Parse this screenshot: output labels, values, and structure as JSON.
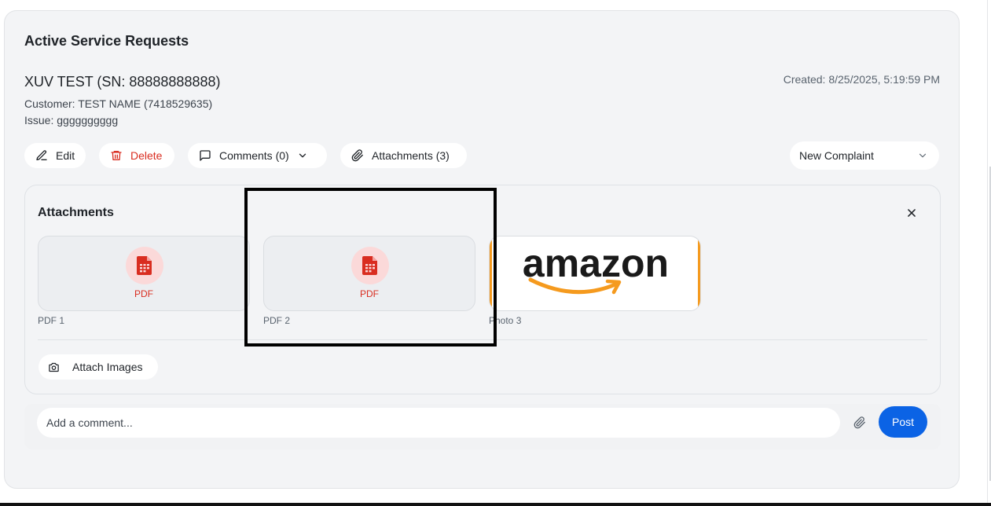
{
  "section": {
    "title": "Active Service Requests"
  },
  "request": {
    "title": "XUV TEST (SN: 88888888888)",
    "customer": "Customer: TEST NAME (7418529635)",
    "issue": "Issue: gggggggggg",
    "created": "Created: 8/25/2025, 5:19:59 PM"
  },
  "toolbar": {
    "edit_label": "Edit",
    "delete_label": "Delete",
    "comments_label": "Comments (0)",
    "attachments_label": "Attachments (3)",
    "status_selected": "New Complaint"
  },
  "attachments": {
    "title": "Attachments",
    "items": [
      {
        "type_label": "PDF",
        "caption": "PDF 1",
        "icon": "pdf-file-icon"
      },
      {
        "type_label": "PDF",
        "caption": "PDF 2",
        "icon": "pdf-file-icon"
      },
      {
        "type_label": "",
        "caption": "Photo 3",
        "icon": "amazon-logo-image"
      }
    ],
    "attach_images_label": "Attach Images"
  },
  "logo": {
    "text": "amazon"
  },
  "comment": {
    "placeholder": "Add a comment...",
    "post_label": "Post"
  },
  "colors": {
    "accent": "#0b63e5",
    "danger": "#d92d20",
    "amazon_orange": "#f59a1e"
  }
}
